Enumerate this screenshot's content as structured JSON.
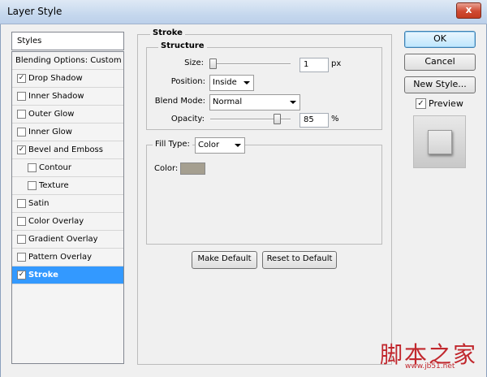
{
  "window": {
    "title": "Layer Style",
    "close_glyph": "x"
  },
  "sidebar": {
    "header": "Styles",
    "items": [
      {
        "label": "Blending Options: Custom",
        "checkbox": false,
        "checked": false,
        "indent": false,
        "selected": false
      },
      {
        "label": "Drop Shadow",
        "checkbox": true,
        "checked": true,
        "indent": false,
        "selected": false
      },
      {
        "label": "Inner Shadow",
        "checkbox": true,
        "checked": false,
        "indent": false,
        "selected": false
      },
      {
        "label": "Outer Glow",
        "checkbox": true,
        "checked": false,
        "indent": false,
        "selected": false
      },
      {
        "label": "Inner Glow",
        "checkbox": true,
        "checked": false,
        "indent": false,
        "selected": false
      },
      {
        "label": "Bevel and Emboss",
        "checkbox": true,
        "checked": true,
        "indent": false,
        "selected": false
      },
      {
        "label": "Contour",
        "checkbox": true,
        "checked": false,
        "indent": true,
        "selected": false
      },
      {
        "label": "Texture",
        "checkbox": true,
        "checked": false,
        "indent": true,
        "selected": false
      },
      {
        "label": "Satin",
        "checkbox": true,
        "checked": false,
        "indent": false,
        "selected": false
      },
      {
        "label": "Color Overlay",
        "checkbox": true,
        "checked": false,
        "indent": false,
        "selected": false
      },
      {
        "label": "Gradient Overlay",
        "checkbox": true,
        "checked": false,
        "indent": false,
        "selected": false
      },
      {
        "label": "Pattern Overlay",
        "checkbox": true,
        "checked": false,
        "indent": false,
        "selected": false
      },
      {
        "label": "Stroke",
        "checkbox": true,
        "checked": true,
        "indent": false,
        "selected": true
      }
    ]
  },
  "stroke": {
    "title": "Stroke",
    "structure_title": "Structure",
    "size_label": "Size:",
    "size_value": "1",
    "size_unit": "px",
    "size_slider_fraction": 0.01,
    "position_label": "Position:",
    "position_value": "Inside",
    "blend_mode_label": "Blend Mode:",
    "blend_mode_value": "Normal",
    "opacity_label": "Opacity:",
    "opacity_value": "85",
    "opacity_unit": "%",
    "opacity_slider_fraction": 0.85,
    "fill_type_label": "Fill Type:",
    "fill_type_value": "Color",
    "color_label": "Color:",
    "stroke_color": "#a59f90",
    "make_default_label": "Make Default",
    "reset_default_label": "Reset to Default"
  },
  "actions": {
    "ok_label": "OK",
    "cancel_label": "Cancel",
    "new_style_label": "New Style...",
    "preview_label": "Preview",
    "preview_checked": true
  },
  "watermark": {
    "text": "脚本之家",
    "url": "www.jb51.net"
  },
  "colors": {
    "selection": "#3399ff",
    "watermark": "#c1272d"
  }
}
